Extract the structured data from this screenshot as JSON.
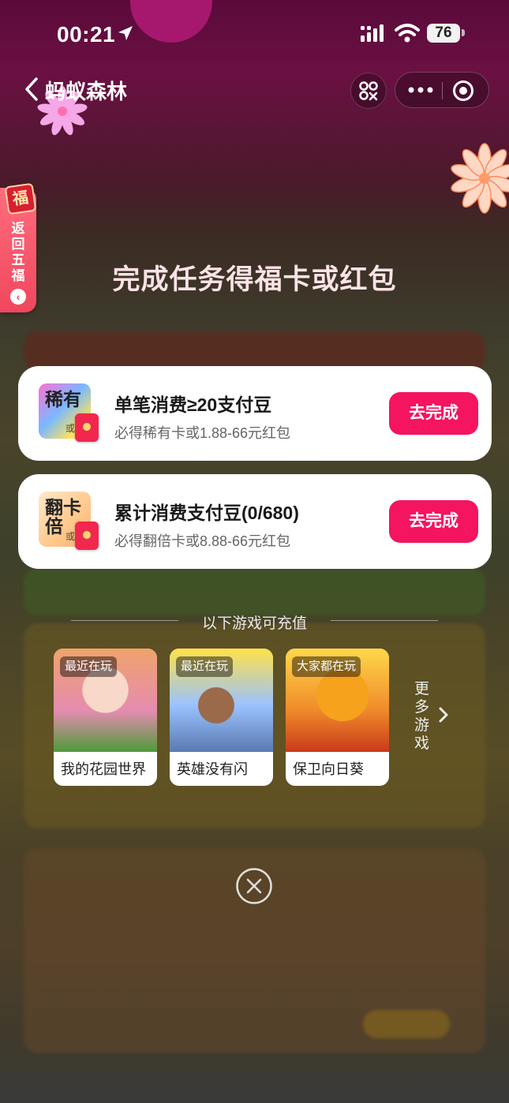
{
  "status_bar": {
    "time": "00:21",
    "battery": "76"
  },
  "nav": {
    "title": "蚂蚁森林"
  },
  "side_tab": {
    "badge": "福",
    "label": "返回五福"
  },
  "headline": "完成任务得福卡或红包",
  "tasks": [
    {
      "icon_text": "稀有",
      "icon_small": "或",
      "title": "单笔消费≥20支付豆",
      "subtitle": "必得稀有卡或1.88-66元红包",
      "button": "去完成"
    },
    {
      "icon_text": "翻卡倍",
      "icon_small": "或",
      "title": "累计消费支付豆(0/680)",
      "subtitle": "必得翻倍卡或8.88-66元红包",
      "button": "去完成"
    }
  ],
  "games": {
    "heading": "以下游戏可充值",
    "items": [
      {
        "tag": "最近在玩",
        "name": "我的花园世界"
      },
      {
        "tag": "最近在玩",
        "name": "英雄没有闪"
      },
      {
        "tag": "大家都在玩",
        "name": "保卫向日葵"
      }
    ],
    "more_label": "更多游戏"
  },
  "colors": {
    "accent": "#f5145f",
    "side_tab": "#f0475e"
  },
  "icons": [
    "location-arrow-icon",
    "signal-icon",
    "wifi-icon",
    "back-icon",
    "scan-icon",
    "more-dots-icon",
    "target-icon",
    "chevron-left-icon",
    "chevron-right-icon",
    "close-icon"
  ]
}
